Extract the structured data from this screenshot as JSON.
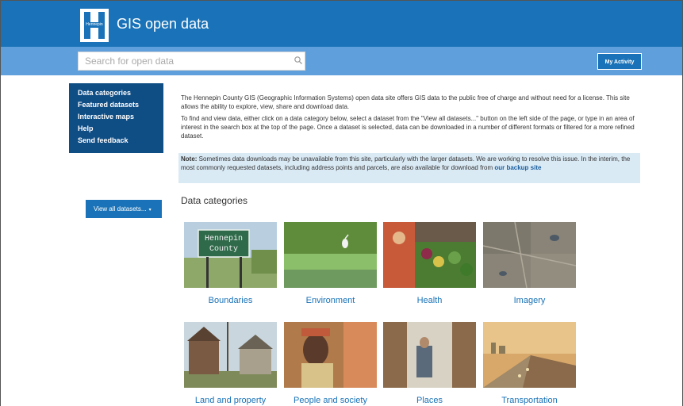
{
  "header": {
    "logo_text": "Hennepin",
    "app_title": "GIS open data"
  },
  "search": {
    "placeholder": "Search for open data"
  },
  "toolbar": {
    "my_activity_label": "My Activity"
  },
  "sidebar": {
    "items": [
      {
        "label": "Data categories"
      },
      {
        "label": "Featured datasets"
      },
      {
        "label": "Interactive maps"
      },
      {
        "label": "Help"
      },
      {
        "label": "Send feedback"
      }
    ],
    "view_all_label": "View all datasets..."
  },
  "main": {
    "intro_1": "The Hennepin County GIS (Geographic Information Systems) open data site offers GIS data to the public free of charge and without need for a license. This site allows the ability to explore, view, share and download data.",
    "intro_2": "To find and view data, either click on a data category below, select a dataset from the \"View all datasets...\" button on the left side of the page, or type in an area of interest in the search box at the top of the page. Once a dataset is selected, data can be downloaded in a number of different formats or filtered for a more refined dataset.",
    "note_label": "Note:",
    "note_text": " Sometimes data downloads may be unavailable from this site, particularly with the larger datasets. We are working to resolve this issue. In the interim, the most commonly requested datasets, including address points and parcels, are also available for download from ",
    "note_link": "our backup site",
    "section_heading": "Data categories",
    "sign_line_1": "Hennepin",
    "sign_line_2": "County",
    "categories": [
      {
        "label": "Boundaries",
        "image": "county-sign-photo"
      },
      {
        "label": "Environment",
        "image": "heron-wetland-photo"
      },
      {
        "label": "Health",
        "image": "produce-market-photo"
      },
      {
        "label": "Imagery",
        "image": "aerial-photo"
      },
      {
        "label": "Land and property",
        "image": "houses-photo"
      },
      {
        "label": "People and society",
        "image": "smiling-people-photo"
      },
      {
        "label": "Places",
        "image": "library-photo"
      },
      {
        "label": "Transportation",
        "image": "highway-sunset-photo"
      }
    ]
  },
  "colors": {
    "header": "#1a73b8",
    "search_bar": "#5f9fdb",
    "sidebar": "#0f4d85",
    "note_bg": "#daeaf5",
    "link": "#1a73b8"
  }
}
